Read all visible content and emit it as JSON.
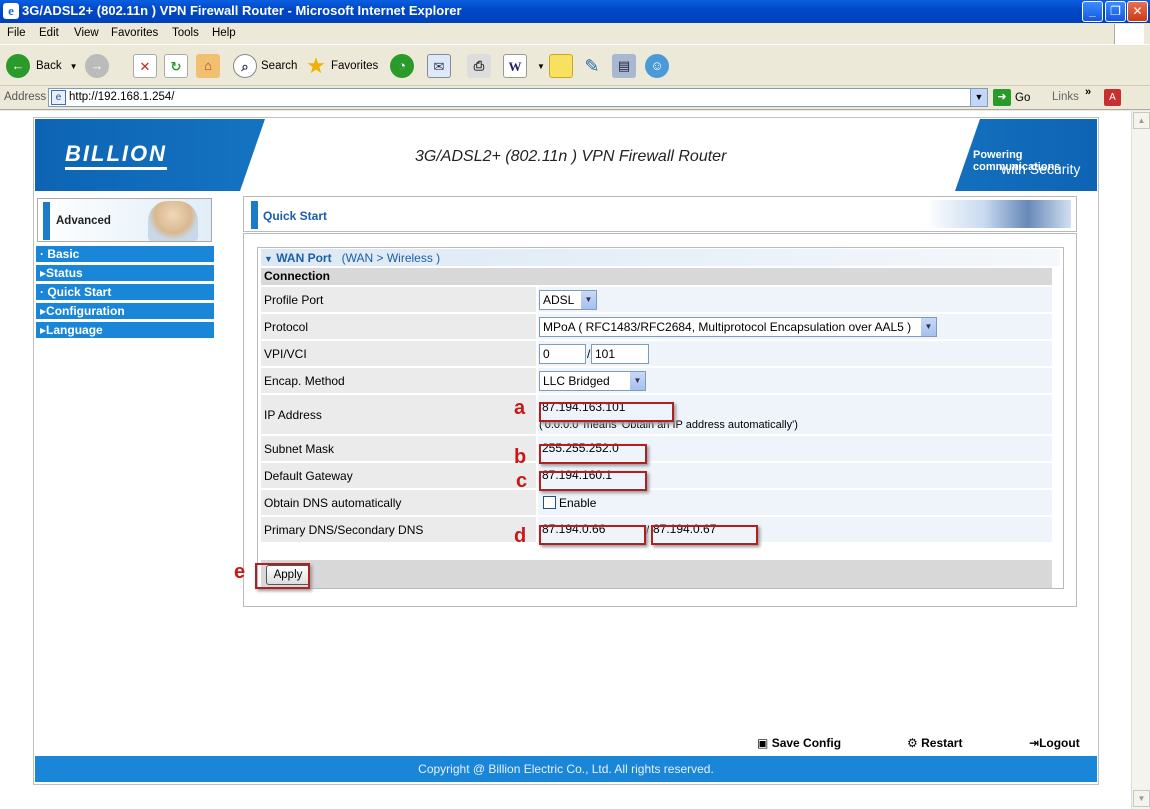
{
  "window": {
    "title": "3G/ADSL2+ (802.11n ) VPN Firewall Router - Microsoft Internet Explorer"
  },
  "menu": [
    "File",
    "Edit",
    "View",
    "Favorites",
    "Tools",
    "Help"
  ],
  "toolbar": {
    "back": "Back",
    "search": "Search",
    "favorites": "Favorites"
  },
  "address": {
    "label": "Address",
    "url": "http://192.168.1.254/",
    "go": "Go",
    "links": "Links"
  },
  "banner": {
    "logo": "BILLION",
    "title": "3G/ADSL2+ (802.11n ) VPN Firewall Router",
    "tagline1": "Powering communications",
    "tagline2": "with Security"
  },
  "nav": {
    "advanced": "Advanced",
    "items": [
      "· Basic",
      "▸Status",
      "· Quick Start",
      "▸Configuration",
      "▸Language"
    ]
  },
  "main": {
    "section_title": "Quick Start",
    "wan_header": "WAN Port",
    "wan_crumb": "(WAN  >  Wireless )",
    "connection": "Connection",
    "fields": {
      "profile_port": {
        "label": "Profile Port",
        "value": "ADSL"
      },
      "protocol": {
        "label": "Protocol",
        "value": "MPoA ( RFC1483/RFC2684, Multiprotocol Encapsulation over AAL5 )"
      },
      "vpi_vci": {
        "label": "VPI/VCI",
        "vpi": "0",
        "vci": "101"
      },
      "encap": {
        "label": "Encap. Method",
        "value": "LLC Bridged"
      },
      "ip": {
        "label": "IP Address",
        "value": "87.194.163.101",
        "hint": "('0.0.0.0' means 'Obtain an IP address automatically')"
      },
      "subnet": {
        "label": "Subnet Mask",
        "value": "255.255.252.0"
      },
      "gateway": {
        "label": "Default Gateway",
        "value": "87.194.160.1"
      },
      "dns_auto": {
        "label": "Obtain DNS automatically",
        "option": "Enable",
        "checked": false
      },
      "dns": {
        "label": "Primary DNS/Secondary DNS",
        "primary": "87.194.0.66",
        "secondary": "87.194.0.67"
      }
    },
    "apply": "Apply",
    "annotations": [
      "a",
      "b",
      "c",
      "d",
      "e"
    ]
  },
  "footer": {
    "save": "Save Config",
    "restart": "Restart",
    "logout": "Logout",
    "copyright": "Copyright @ Billion Electric Co., Ltd. All rights reserved."
  },
  "colors": {
    "accent": "#1a86d8",
    "annotation": "#c81818"
  }
}
